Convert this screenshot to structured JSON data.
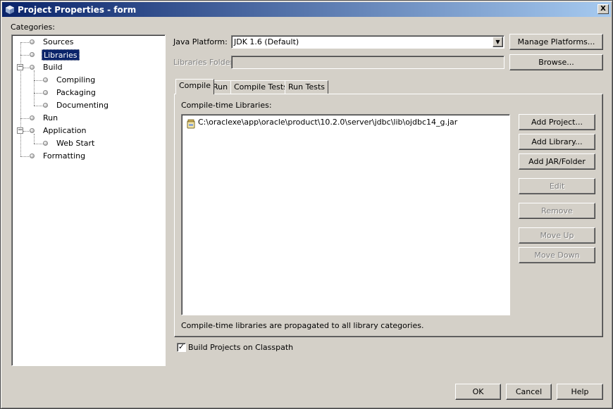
{
  "window": {
    "title": "Project Properties - form",
    "close_glyph": "X"
  },
  "categories": {
    "label": "Categories:",
    "items": [
      {
        "label": "Sources"
      },
      {
        "label": "Libraries"
      },
      {
        "label": "Build"
      },
      {
        "label": "Compiling"
      },
      {
        "label": "Packaging"
      },
      {
        "label": "Documenting"
      },
      {
        "label": "Run"
      },
      {
        "label": "Application"
      },
      {
        "label": "Web Start"
      },
      {
        "label": "Formatting"
      }
    ],
    "selected": "Libraries",
    "toggle_glyph": "−"
  },
  "platform": {
    "label": "Java Platform:",
    "value": "JDK 1.6 (Default)",
    "manage_button": "Manage Platforms..."
  },
  "libraries_folder": {
    "label": "Libraries Folder:",
    "value": "",
    "browse_button": "Browse..."
  },
  "tabs": [
    {
      "label": "Compile",
      "active": true
    },
    {
      "label": "Run"
    },
    {
      "label": "Compile Tests"
    },
    {
      "label": "Run Tests"
    }
  ],
  "compile": {
    "list_label": "Compile-time Libraries:",
    "entries": [
      {
        "path": "C:\\oraclexe\\app\\oracle\\product\\10.2.0\\server\\jdbc\\lib\\ojdbc14_g.jar",
        "icon": "jar-icon"
      }
    ],
    "buttons": {
      "add_project": "Add Project...",
      "add_library": "Add Library...",
      "add_jar": "Add JAR/Folder",
      "edit": "Edit",
      "remove": "Remove",
      "move_up": "Move Up",
      "move_down": "Move Down"
    },
    "note": "Compile-time libraries are propagated to all library categories."
  },
  "build_on_classpath": {
    "label": "Build Projects on Classpath",
    "checked": true,
    "check_glyph": "✓"
  },
  "footer": {
    "ok": "OK",
    "cancel": "Cancel",
    "help": "Help"
  },
  "colors": {
    "title_bar_start": "#0a246a",
    "title_bar_end": "#a6caf0",
    "selection": "#0a246a",
    "dialog_face": "#d4d0c8"
  }
}
